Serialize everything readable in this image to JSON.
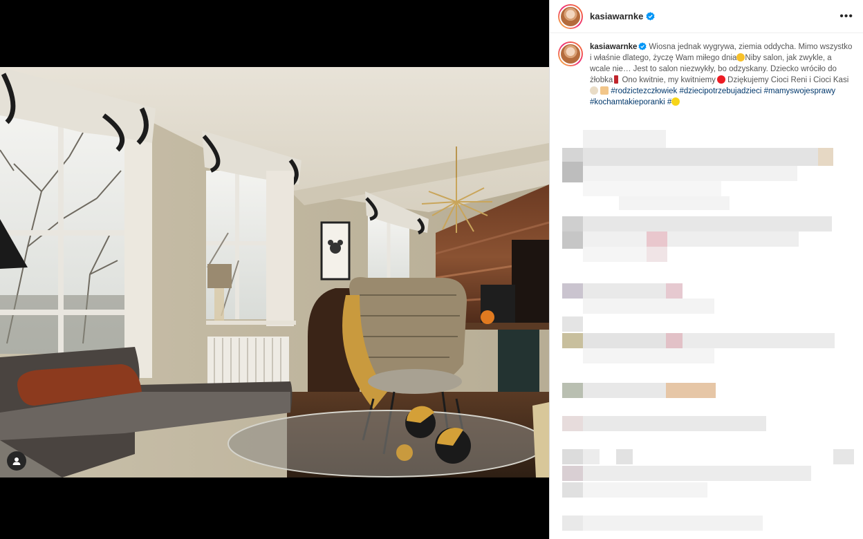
{
  "post": {
    "username": "kasiawarnke",
    "verified": true,
    "more_label": "•••"
  },
  "caption": {
    "username": "kasiawarnke",
    "text_1": "Wiosna jednak wygrywa, ziemia oddycha. Mimo wszystko i właśnie dlatego, życzę Wam miłego dnia",
    "text_2": "Niby salon, jak zwykle, a wcale nie… Jest to salon niezwykły, bo odzyskany. Dziecko wróciło do żłobka",
    "text_3": "Ono kwitnie, my kwitniemy",
    "text_4": "Dziękujemy Cioci Reni i Cioci Kasi",
    "hashtags": [
      "#rodzictezczłowiek",
      "#dziecipotrzebujadzieci",
      "#mamyswojesprawy",
      "#kochamtakieporanki",
      "#"
    ]
  },
  "icons": {
    "verified": "verified-badge-icon",
    "user_tag": "user-tag-icon",
    "more": "more-options-icon"
  },
  "colors": {
    "hashtag": "#00376b",
    "verified": "#0095f6",
    "heart": "#ed1c24"
  }
}
